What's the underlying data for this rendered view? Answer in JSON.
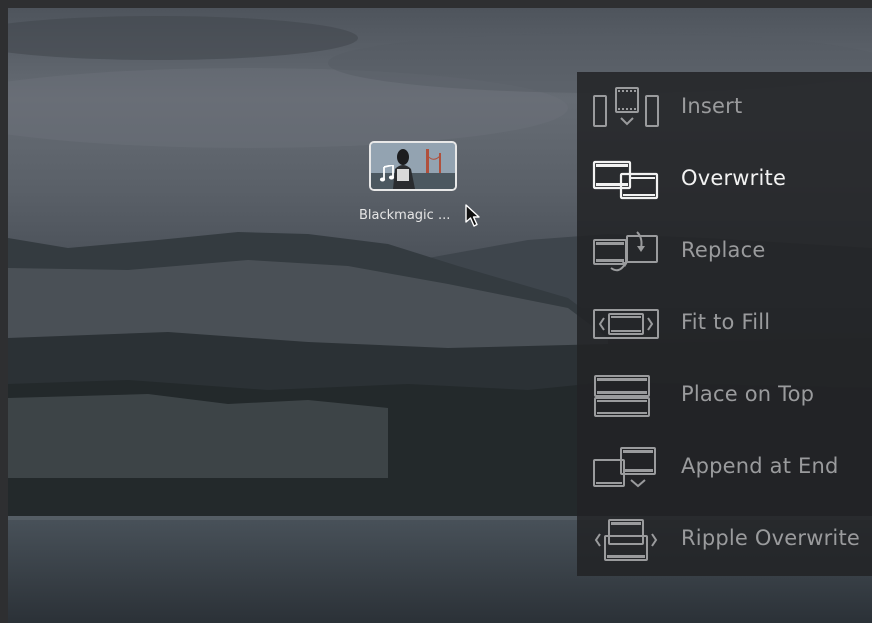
{
  "viewer": {
    "clip": {
      "label": "Blackmagic ...",
      "badge_icon": "music-note-icon"
    }
  },
  "overlay": {
    "active_index": 1,
    "items": [
      {
        "label": "Insert",
        "icon": "insert-icon"
      },
      {
        "label": "Overwrite",
        "icon": "overwrite-icon"
      },
      {
        "label": "Replace",
        "icon": "replace-icon"
      },
      {
        "label": "Fit to Fill",
        "icon": "fit-to-fill-icon"
      },
      {
        "label": "Place on Top",
        "icon": "place-on-top-icon"
      },
      {
        "label": "Append at End",
        "icon": "append-at-end-icon"
      },
      {
        "label": "Ripple Overwrite",
        "icon": "ripple-overwrite-icon"
      }
    ]
  },
  "colors": {
    "active_text": "#f2f2f2",
    "inactive_text": "#9a9b9d",
    "overlay_bg": "#222325"
  }
}
